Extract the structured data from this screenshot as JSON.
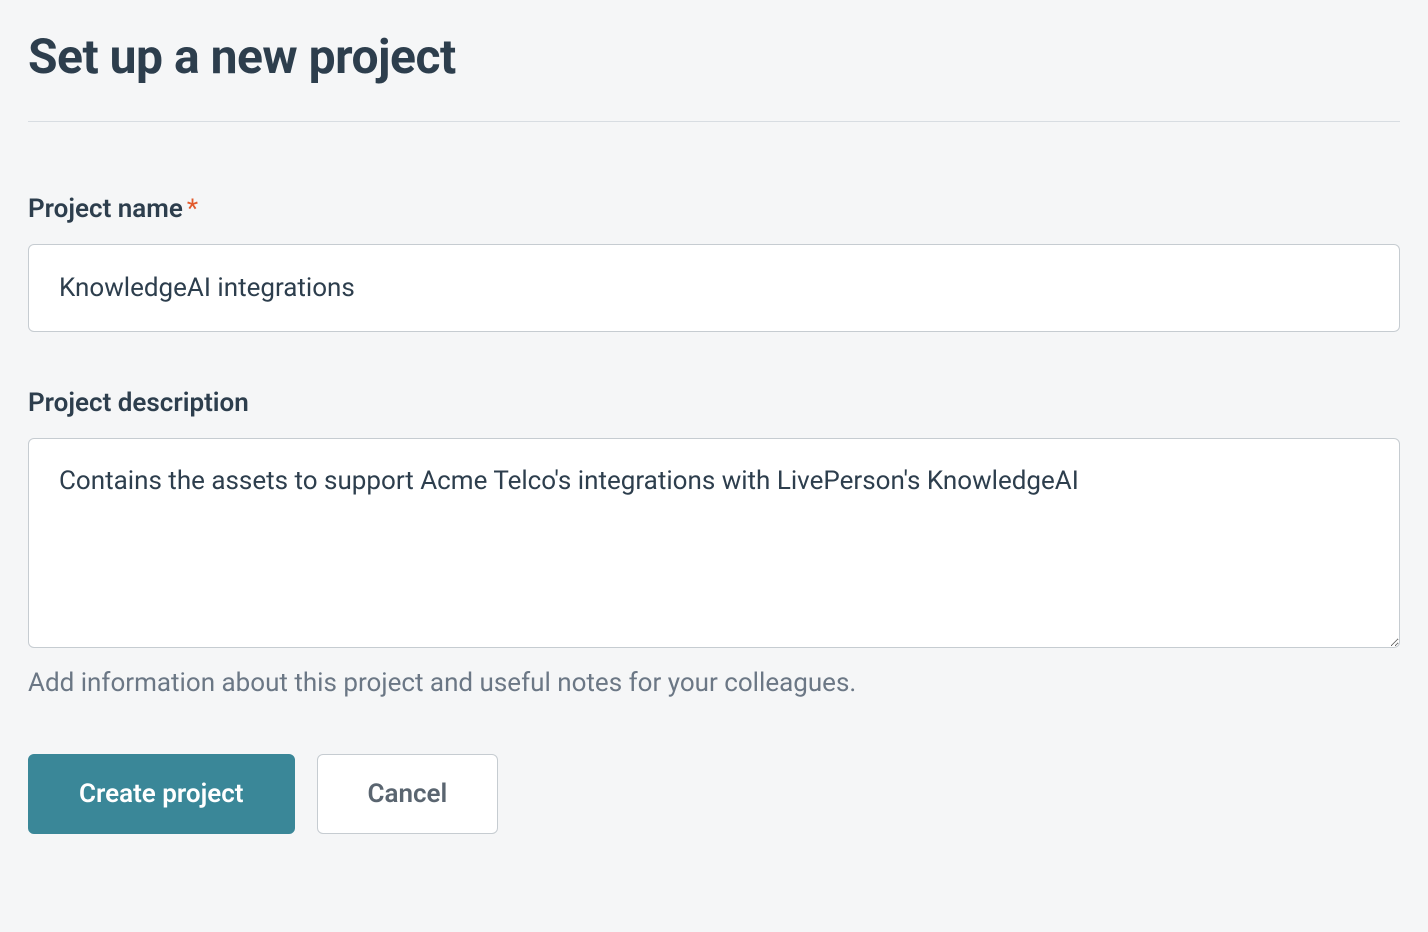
{
  "header": {
    "title": "Set up a new project"
  },
  "form": {
    "project_name": {
      "label": "Project name",
      "required_marker": "*",
      "value": "KnowledgeAI integrations"
    },
    "project_description": {
      "label": "Project description",
      "value": "Contains the assets to support Acme Telco's integrations with LivePerson's KnowledgeAI",
      "helper_text": "Add information about this project and useful notes for your colleagues."
    }
  },
  "actions": {
    "primary_label": "Create project",
    "secondary_label": "Cancel"
  }
}
